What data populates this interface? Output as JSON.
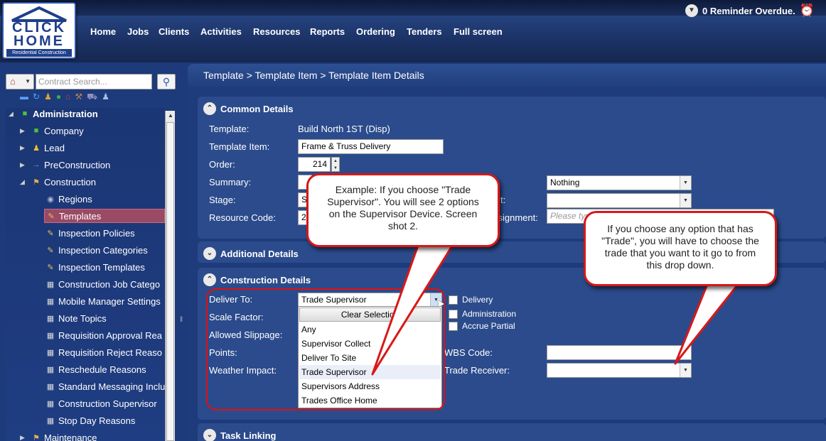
{
  "header": {
    "logo": {
      "line1": "CLICK",
      "line2": "HOME",
      "tagline": "Residential Construction"
    },
    "nav": [
      "Home",
      "Jobs",
      "Clients",
      "Activities",
      "Resources",
      "Reports",
      "Ordering",
      "Tenders",
      "Full screen"
    ],
    "reminder": "0 Reminder Overdue."
  },
  "sidebar": {
    "search_placeholder": "Contract Search...",
    "tree": [
      {
        "label": "Administration",
        "level": 0
      },
      {
        "label": "Company",
        "level": 1
      },
      {
        "label": "Lead",
        "level": 1
      },
      {
        "label": "PreConstruction",
        "level": 1
      },
      {
        "label": "Construction",
        "level": 1
      },
      {
        "label": "Regions",
        "level": 2
      },
      {
        "label": "Templates",
        "level": 2,
        "selected": true
      },
      {
        "label": "Inspection Policies",
        "level": 2
      },
      {
        "label": "Inspection Categories",
        "level": 2
      },
      {
        "label": "Inspection Templates",
        "level": 2
      },
      {
        "label": "Construction Job Catego",
        "level": 2
      },
      {
        "label": "Mobile Manager Settings",
        "level": 2
      },
      {
        "label": "Note Topics",
        "level": 2
      },
      {
        "label": "Requisition Approval Rea",
        "level": 2
      },
      {
        "label": "Requisition Reject Reaso",
        "level": 2
      },
      {
        "label": "Reschedule Reasons",
        "level": 2
      },
      {
        "label": "Standard Messaging Inclu",
        "level": 2
      },
      {
        "label": "Construction Supervisor",
        "level": 2
      },
      {
        "label": "Stop Day Reasons",
        "level": 2
      },
      {
        "label": "Maintenance",
        "level": 1
      }
    ]
  },
  "main": {
    "breadcrumb": "Template > Template Item > Template Item Details",
    "common": {
      "title": "Common Details",
      "template_label": "Template:",
      "template_value": "Build North 1ST (Disp)",
      "item_label": "Template Item:",
      "item_value": "Frame & Truss Delivery",
      "order_label": "Order:",
      "order_value": "214",
      "summary_label": "Summary:",
      "stage_label": "Stage:",
      "stage_value": "S",
      "resource_label": "Resource Code:",
      "resource_value": "2",
      "right_select1": "Nothing",
      "right_label2": "t:",
      "right_label3": "ssignment:",
      "right_placeholder": "Please typ"
    },
    "additional": {
      "title": "Additional Details"
    },
    "construction": {
      "title": "Construction Details",
      "deliver_label": "Deliver To:",
      "deliver_value": "Trade Supervisor",
      "scale_label": "Scale Factor:",
      "slippage_label": "Allowed Slippage:",
      "points_label": "Points:",
      "weather_label": "Weather Impact:",
      "checkboxes": [
        "Delivery",
        "Administration",
        "Accrue Partial"
      ],
      "wbs_label": "WBS Code:",
      "trade_receiver_label": "Trade Receiver:",
      "dropdown": {
        "clear": "Clear Selection",
        "options": [
          "Any",
          "Supervisor Collect",
          "Deliver To Site",
          "Trade Supervisor",
          "Supervisors Address",
          "Trades Office Home"
        ],
        "selected": "Trade Supervisor"
      }
    },
    "task": {
      "title": "Task Linking"
    }
  },
  "callouts": {
    "left": "Example: If you choose \"Trade Supervisor\". You will see 2 options on the Supervisor Device. Screen shot 2.",
    "right": "If you choose any option that has \"Trade\", you will have to choose the trade that you want to it go to from this drop down."
  }
}
